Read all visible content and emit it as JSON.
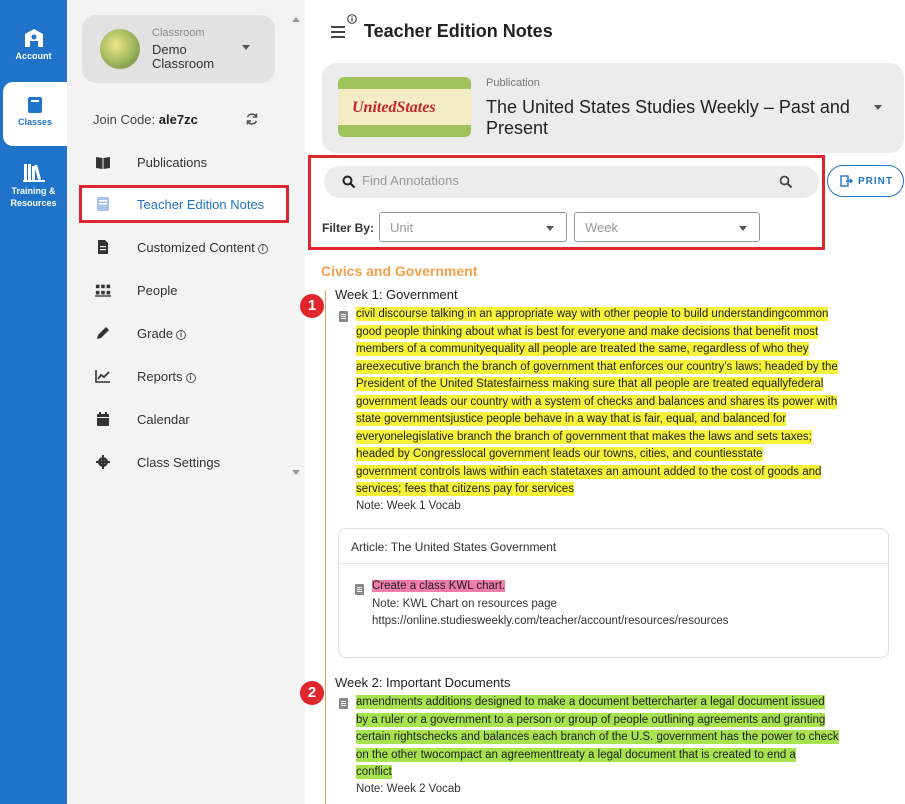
{
  "rail": {
    "items": [
      {
        "label": "Account",
        "icon": "account-icon"
      },
      {
        "label": "Classes",
        "icon": "book-icon",
        "active": true
      },
      {
        "label": "Training & Resources",
        "icon": "library-icon"
      }
    ]
  },
  "sidebar": {
    "classroom_caption": "Classroom",
    "classroom_name": "Demo Classroom",
    "join_code_label": "Join Code:",
    "join_code_value": "ale7zc",
    "items": [
      {
        "label": "Publications",
        "icon": "open-book-icon"
      },
      {
        "label": "Teacher Edition Notes",
        "icon": "notes-icon",
        "active": true
      },
      {
        "label": "Customized Content",
        "icon": "document-icon",
        "info": true
      },
      {
        "label": "People",
        "icon": "people-icon"
      },
      {
        "label": "Grade",
        "icon": "pencil-icon",
        "info": true
      },
      {
        "label": "Reports",
        "icon": "chart-icon",
        "info": true
      },
      {
        "label": "Calendar",
        "icon": "calendar-icon"
      },
      {
        "label": "Class Settings",
        "icon": "gear-icon"
      }
    ]
  },
  "header": {
    "title": "Teacher Edition Notes"
  },
  "publication": {
    "caption": "Publication",
    "title": "The United States Studies Weekly – Past and Present",
    "thumb_text": "UnitedStates"
  },
  "search": {
    "placeholder": "Find Annotations",
    "filter_label": "Filter By:",
    "unit_placeholder": "Unit",
    "week_placeholder": "Week",
    "print_label": "PRINT"
  },
  "colors": {
    "accent": "#1f73c9",
    "annotation_red": "#e0262d",
    "unit_orange": "#f0a04b",
    "highlight_yellow": "#f6f23a",
    "highlight_green": "#a6e34f",
    "highlight_pink": "#f07ca8"
  },
  "content": {
    "unit_title": "Civics and Government",
    "weeks": [
      {
        "badge": "1",
        "title": "Week 1: Government",
        "lines": [
          "civil discourse  talking in an appropriate way with other people to build understandingcommon",
          "good  people thinking about what is best for everyone and make decisions that benefit most",
          "members of a communityequality  all people are treated the same, regardless of who they",
          "areexecutive branch  the branch of government that enforces our country’s laws; headed by the",
          "President of the United Statesfairness  making sure that all people are treated equallyfederal",
          "government  leads our country with a system of checks and balances and shares its power with",
          "state governmentsjustice  people behave in a way that is fair, equal, and balanced for",
          "everyonelegislative branch  the branch of government that makes the laws and sets taxes;",
          "headed by Congresslocal government  leads our towns, cities, and countiesstate",
          "government  controls laws within each statetaxes  an amount added to the cost of goods and",
          "services; fees that citizens pay for services"
        ],
        "note": "Note: Week 1 Vocab",
        "article": {
          "title": "Article: The United States Government",
          "highlight": "Create a class KWL chart.",
          "note": "Note: KWL Chart on resources page",
          "link": "https://online.studiesweekly.com/teacher/account/resources/resources"
        }
      },
      {
        "badge": "2",
        "title": "Week 2: Important Documents",
        "lines": [
          "amendments  additions designed to make a document bettercharter  a legal document issued",
          "by a ruler or a government to a person or group of people outlining agreements and granting",
          "certain rightschecks and balances  each branch of the U.S. government has the power to check",
          "on the other twocompact  an agreementtreaty  a legal document that is created to end a",
          "conflict"
        ],
        "note": "Note: Week 2 Vocab"
      }
    ]
  }
}
